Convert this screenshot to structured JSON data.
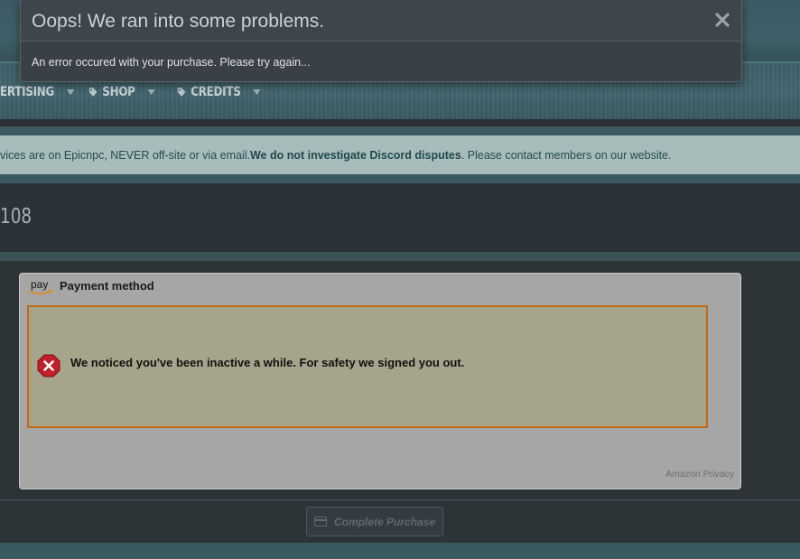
{
  "nav": {
    "items": [
      {
        "label": "ERTISING",
        "has_tag_icon": false
      },
      {
        "label": "SHOP",
        "has_tag_icon": true
      },
      {
        "label": "CREDITS",
        "has_tag_icon": true
      }
    ]
  },
  "notice": {
    "text_before": "vices are on Epicnpc, NEVER off-site or via email. ",
    "bold": "We do not investigate Discord disputes",
    "text_after": ". Please contact members on our website."
  },
  "page": {
    "title": "108"
  },
  "payment": {
    "logo_text": "pay",
    "title": "Payment method",
    "alert_text": "We noticed you've been inactive a while. For safety we signed you out.",
    "privacy_link": "Amazon Privacy"
  },
  "actions": {
    "complete_purchase": "Complete Purchase"
  },
  "modal": {
    "title": "Oops! We ran into some problems.",
    "message": "An error occured with your purchase. Please try again..."
  },
  "colors": {
    "alert_border": "#c06a14",
    "notice_bg": "#a9bcbc",
    "error_red": "#c0202a"
  }
}
